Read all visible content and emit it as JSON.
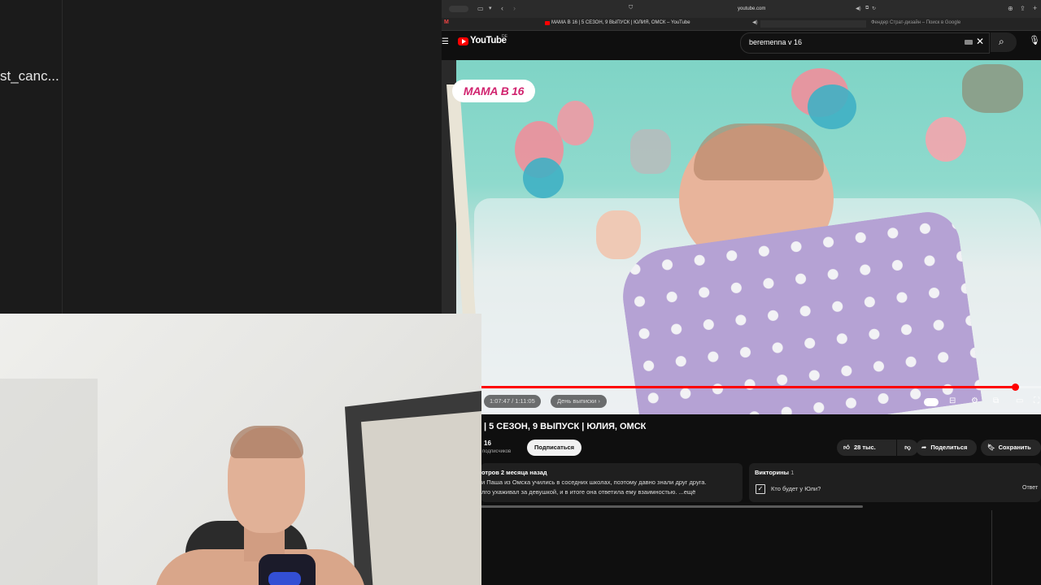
{
  "left_pane": {
    "text": "st_canc..."
  },
  "browser": {
    "url": "youtube.com",
    "tabs": [
      {
        "title": "МАМА В 16 | 5 СЕЗОН, 9 ВЫПУСК | ЮЛИЯ, ОМСК – YouTube"
      },
      {
        "title": "Фендер Страт-дизайн – Поиск в Google"
      }
    ]
  },
  "youtube": {
    "logo_text": "YouTube",
    "region": "DE",
    "search_value": "beremenna v 16",
    "video": {
      "badge_text": "МАМА В 16",
      "time": "1:07:47 / 1:11:05",
      "chapter": "День выписки",
      "progress": 0.953
    },
    "title": "| 5 СЕЗОН, 9 ВЫПУСК | ЮЛИЯ, ОМСК",
    "channel_name": "16",
    "subscribers": "подписчиков",
    "subscribe_label": "Подписаться",
    "likes_label": "28 тыс.",
    "share_label": "Поделиться",
    "save_label": "Сохранить",
    "description": {
      "meta": "отров  2 месяца назад",
      "line1": "и Паша из Омска учились в соседних школах, поэтому давно знали друг друга.",
      "line2": "лго ухаживал за девушкой, и в итоге она ответила ему взаимностью.  ...ещё"
    },
    "quiz": {
      "title": "Викторины",
      "count": "1",
      "question": "Кто будет у Юли?",
      "answer_label": "Ответ"
    }
  }
}
